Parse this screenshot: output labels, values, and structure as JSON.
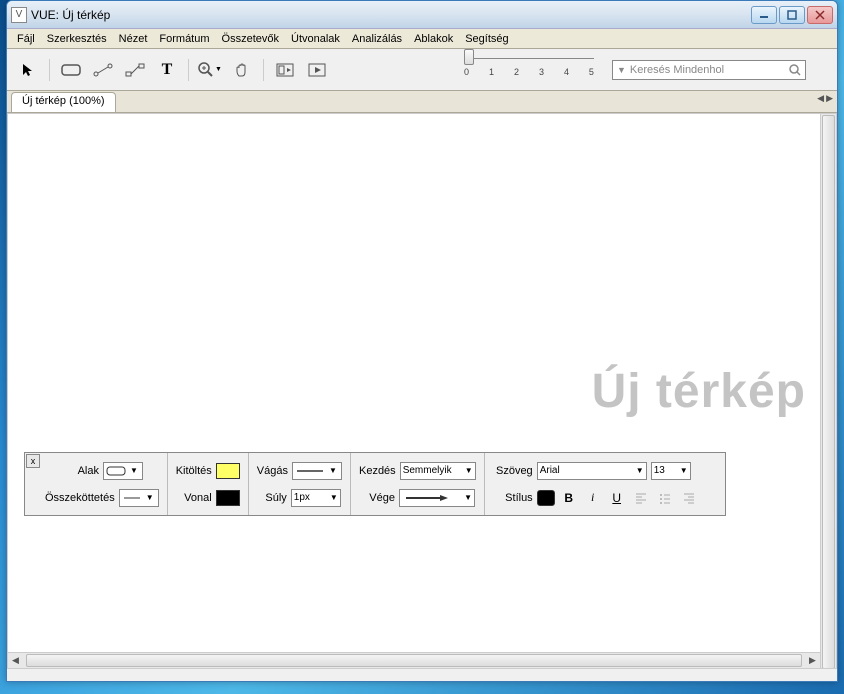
{
  "window": {
    "title": "VUE: Új térkép"
  },
  "menu": [
    "Fájl",
    "Szerkesztés",
    "Nézet",
    "Formátum",
    "Összetevők",
    "Útvonalak",
    "Analizálás",
    "Ablakok",
    "Segítség"
  ],
  "slider": {
    "ticks": [
      "0",
      "1",
      "2",
      "3",
      "4",
      "5"
    ]
  },
  "search": {
    "placeholder": "Keresés Mindenhol"
  },
  "tab": {
    "label": "Új térkép (100%)"
  },
  "canvas": {
    "watermark": "Új térkép"
  },
  "format_panel": {
    "alak": "Alak",
    "osszekottetes": "Összeköttetés",
    "kitoltes": "Kitöltés",
    "vonal": "Vonal",
    "vagas": "Vágás",
    "suly": "Súly",
    "suly_val": "1px",
    "kezdes": "Kezdés",
    "kezdes_val": "Semmelyik",
    "vege": "Vége",
    "szoveg": "Szöveg",
    "font": "Arial",
    "size": "13",
    "stilus": "Stílus",
    "close": "x"
  },
  "colors": {
    "fill": "#ffff66",
    "line": "#000000",
    "text": "#000000"
  }
}
